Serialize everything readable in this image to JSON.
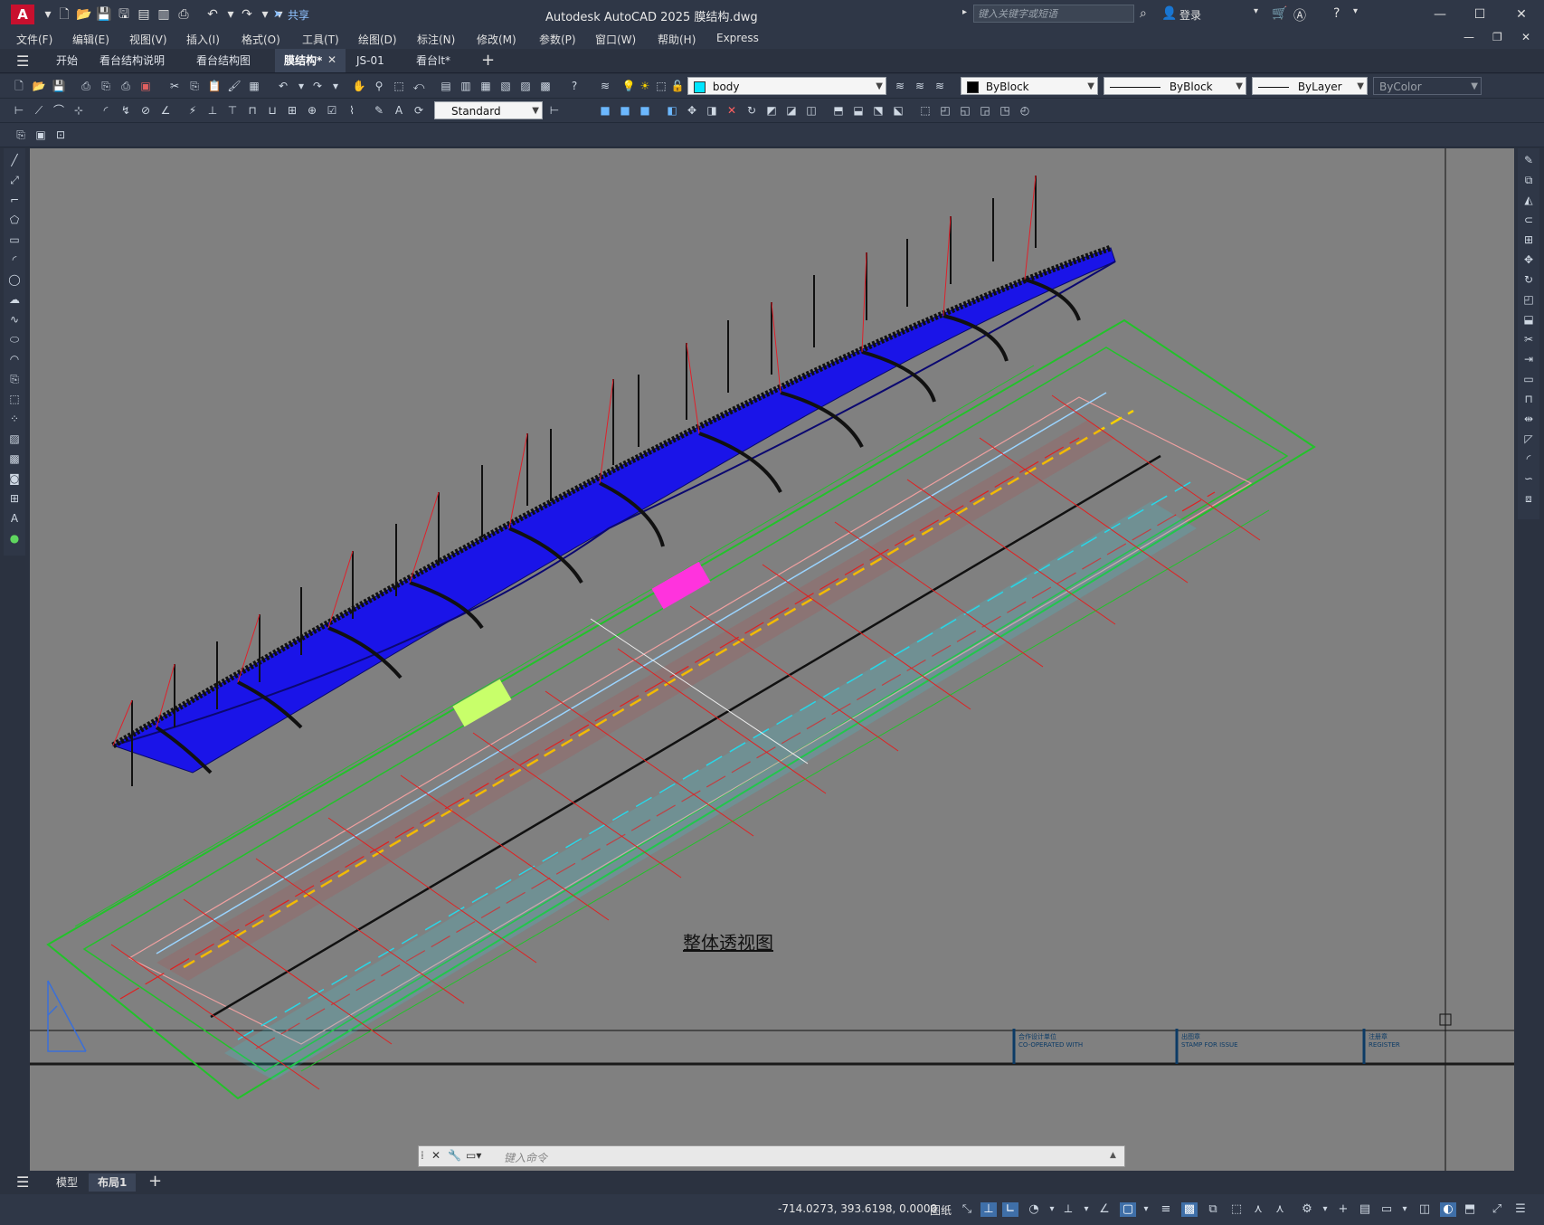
{
  "app": {
    "window_title": "Autodesk AutoCAD 2025    膜结构.dwg",
    "share_label": "共享",
    "search_placeholder": "键入关键字或短语",
    "login_label": "登录"
  },
  "menus": [
    "文件(F)",
    "编辑(E)",
    "视图(V)",
    "插入(I)",
    "格式(O)",
    "工具(T)",
    "绘图(D)",
    "标注(N)",
    "修改(M)",
    "参数(P)",
    "窗口(W)",
    "帮助(H)",
    "Express"
  ],
  "doc_tabs": [
    "开始",
    "看台结构说明",
    "看台结构图",
    "膜结构*",
    "JS-01",
    "看台lt*"
  ],
  "active_doc_tab": "膜结构*",
  "properties": {
    "layer": "body",
    "color": "ByBlock",
    "linetype": "ByBlock",
    "lineweight": "ByLayer",
    "plotstyle": "ByColor",
    "text_style": "Standard"
  },
  "drawing": {
    "title": "整体透视图",
    "title_block": [
      "合作设计单位",
      "CO-OPERATED WITH",
      "出图章",
      "STAMP FOR ISSUE",
      "注册章",
      "REGISTER"
    ],
    "colors": {
      "membrane": "#1a14e8",
      "truss": "#111111",
      "cable": "#e0202a",
      "grid": "#22c22a",
      "axis": "#e02020",
      "accent": "#f5d000"
    }
  },
  "command": {
    "placeholder": "键入命令"
  },
  "layout_tabs": [
    "模型",
    "布局1"
  ],
  "active_layout_tab": "布局1",
  "status": {
    "coords": "-714.0273, 393.6198, 0.0000",
    "space": "图纸"
  }
}
